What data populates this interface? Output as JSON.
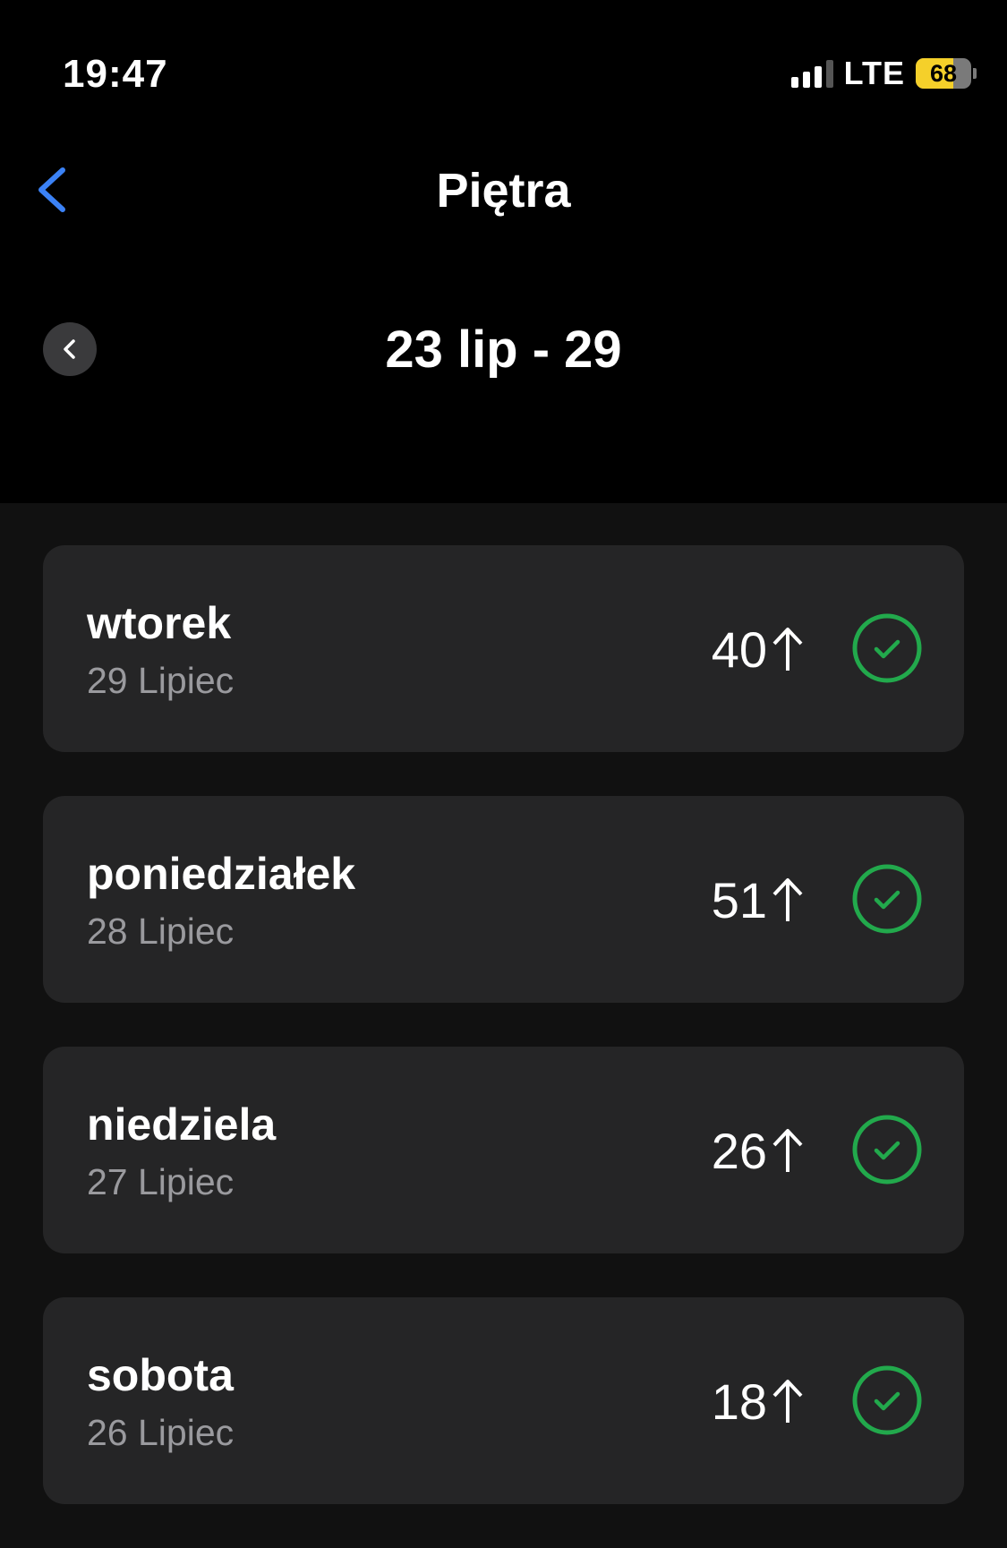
{
  "status_bar": {
    "time": "19:47",
    "network": "LTE",
    "battery": "68",
    "battery_level": 0.68,
    "signal_bars_active": 3,
    "signal_bars_total": 4
  },
  "nav": {
    "back_icon": "chevron-left-icon",
    "title": "Piętra"
  },
  "period": {
    "back_icon": "chevron-left-icon",
    "label": "23 lip - 29"
  },
  "colors": {
    "accent": "#3b82f6",
    "success": "#22a94c",
    "card": "#252526",
    "background": "#111111"
  },
  "days": [
    {
      "name": "wtorek",
      "date": "29 Lipiec",
      "count": "40",
      "status_icon": "check-circle-icon"
    },
    {
      "name": "poniedziałek",
      "date": "28 Lipiec",
      "count": "51",
      "status_icon": "check-circle-icon"
    },
    {
      "name": "niedziela",
      "date": "27 Lipiec",
      "count": "26",
      "status_icon": "check-circle-icon"
    },
    {
      "name": "sobota",
      "date": "26 Lipiec",
      "count": "18",
      "status_icon": "check-circle-icon"
    }
  ]
}
